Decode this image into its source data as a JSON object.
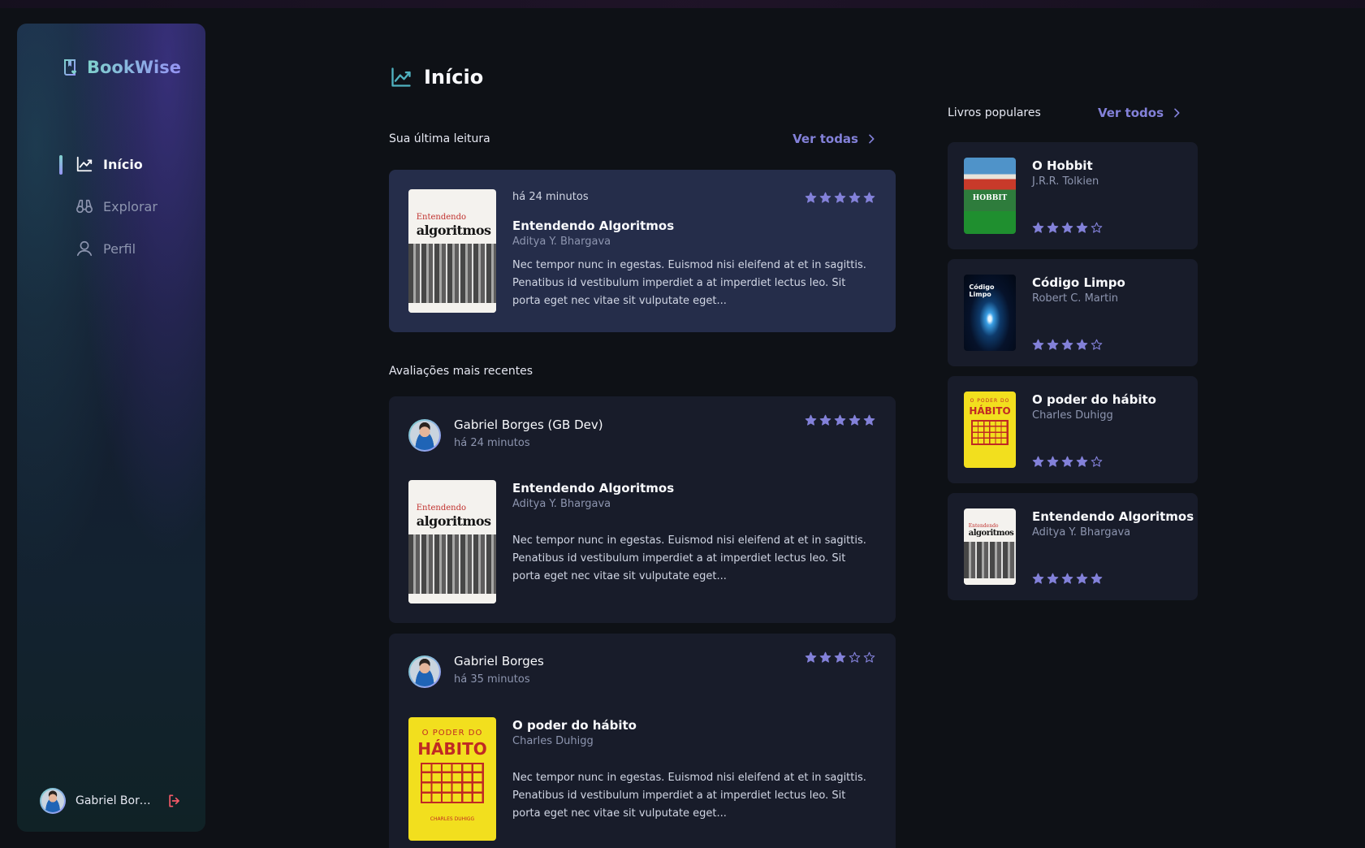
{
  "app": {
    "name": "BookWise"
  },
  "colors": {
    "accent": "#8381d9",
    "star": "#8381d9",
    "logout": "#f75a68",
    "card": "#181c2a",
    "card_highlight": "#252d4a"
  },
  "sidebar": {
    "items": [
      {
        "label": "Início",
        "icon": "chart-line-up-icon",
        "active": true
      },
      {
        "label": "Explorar",
        "icon": "binoculars-icon",
        "active": false
      },
      {
        "label": "Perfil",
        "icon": "user-icon",
        "active": false
      }
    ],
    "user": {
      "name": "Gabriel Borge...",
      "logout_icon": "sign-out-icon"
    }
  },
  "main": {
    "title": "Início",
    "last_reading": {
      "label": "Sua última leitura",
      "link": "Ver todas",
      "time": "há 24 minutos",
      "rating": 5,
      "book": {
        "title": "Entendendo Algoritmos",
        "author": "Aditya Y. Bhargava",
        "cover_title_small": "Entendendo",
        "cover_title_big": "algoritmos"
      },
      "description": "Nec tempor nunc in egestas. Euismod nisi eleifend at et in sagittis. Penatibus id vestibulum imperdiet a at imperdiet lectus leo. Sit porta eget nec vitae sit vulputate eget..."
    },
    "recent": {
      "label": "Avaliações mais recentes",
      "reviews": [
        {
          "user": "Gabriel Borges (GB Dev)",
          "time": "há 24 minutos",
          "rating": 5,
          "book": {
            "title": "Entendendo Algoritmos",
            "author": "Aditya Y. Bhargava",
            "cover_title_small": "Entendendo",
            "cover_title_big": "algoritmos"
          },
          "description": "Nec tempor nunc in egestas. Euismod nisi eleifend at et in sagittis. Penatibus id vestibulum imperdiet a at imperdiet lectus leo. Sit porta eget nec vitae sit vulputate eget..."
        },
        {
          "user": "Gabriel Borges",
          "time": "há 35 minutos",
          "rating": 3,
          "book": {
            "title": "O poder do hábito",
            "author": "Charles Duhigg",
            "cover_line1": "O PODER DO",
            "cover_line2": "HÁBITO",
            "cover_line3": "CHARLES DUHIGG"
          },
          "description": "Nec tempor nunc in egestas. Euismod nisi eleifend at et in sagittis. Penatibus id vestibulum imperdiet a at imperdiet lectus leo. Sit porta eget nec vitae sit vulputate eget..."
        }
      ]
    }
  },
  "popular": {
    "label": "Livros populares",
    "link": "Ver todos",
    "books": [
      {
        "title": "O Hobbit",
        "author": "J.R.R. Tolkien",
        "rating": 4,
        "cover_text": "HOBBIT"
      },
      {
        "title": "Código Limpo",
        "author": "Robert C. Martin",
        "rating": 4,
        "cover_text": "Código Limpo"
      },
      {
        "title": "O poder do hábito",
        "author": "Charles Duhigg",
        "rating": 4,
        "cover_line1": "O PODER DO",
        "cover_line2": "HÁBITO"
      },
      {
        "title": "Entendendo Algoritmos",
        "author": "Aditya Y. Bhargava",
        "rating": 5,
        "cover_title_small": "Entendendo",
        "cover_title_big": "algoritmos"
      }
    ]
  }
}
